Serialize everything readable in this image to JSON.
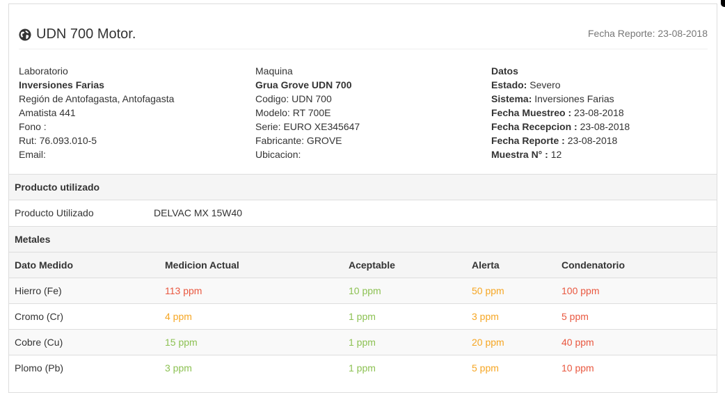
{
  "header": {
    "title": "UDN 700 Motor.",
    "report_date": "Fecha Reporte: 23-08-2018"
  },
  "laboratory": {
    "label": "Laboratorio",
    "name": "Inversiones Farias",
    "region": "Región de Antofagasta, Antofagasta",
    "address": "Amatista 441",
    "phone": "Fono :",
    "rut": "Rut: 76.093.010-5",
    "email": "Email:"
  },
  "machine": {
    "label": "Maquina",
    "name": "Grua Grove UDN 700",
    "codigo": "Codigo: UDN 700",
    "modelo": "Modelo: RT 700E",
    "serie": "Serie: EURO XE345647",
    "fabricante": "Fabricante: GROVE",
    "ubicacion": "Ubicacion:"
  },
  "datos": {
    "label": "Datos",
    "estado_label": "Estado:",
    "estado_value": " Severo",
    "sistema_label": "Sistema:",
    "sistema_value": " Inversiones Farias",
    "muestreo_label": "Fecha Muestreo :",
    "muestreo_value": " 23-08-2018",
    "recepcion_label": "Fecha Recepcion :",
    "recepcion_value": " 23-08-2018",
    "reporte_label": "Fecha Reporte :",
    "reporte_value": " 23-08-2018",
    "muestra_label": "Muestra N° :",
    "muestra_value": " 12"
  },
  "producto": {
    "section_title": "Producto utilizado",
    "row_label": "Producto Utilizado",
    "row_value": "DELVAC MX 15W40"
  },
  "metales": {
    "section_title": "Metales",
    "columns": [
      "Dato Medido",
      "Medicion Actual",
      "Aceptable",
      "Alerta",
      "Condenatorio"
    ],
    "rows": [
      {
        "name": "Hierro (Fe)",
        "actual": "113 ppm",
        "aceptable": "10 ppm",
        "alerta": "50 ppm",
        "condenatorio": "100 ppm"
      },
      {
        "name": "Cromo (Cr)",
        "actual": "4 ppm",
        "aceptable": "1 ppm",
        "alerta": "3 ppm",
        "condenatorio": "5 ppm"
      },
      {
        "name": "Cobre (Cu)",
        "actual": "15 ppm",
        "aceptable": "1 ppm",
        "alerta": "20 ppm",
        "condenatorio": "40 ppm"
      },
      {
        "name": "Plomo (Pb)",
        "actual": "3 ppm",
        "aceptable": "1 ppm",
        "alerta": "5 ppm",
        "condenatorio": "10 ppm"
      }
    ]
  },
  "colors": {
    "green": "#8cc152",
    "orange": "#f6a623",
    "red": "#e9573f"
  }
}
